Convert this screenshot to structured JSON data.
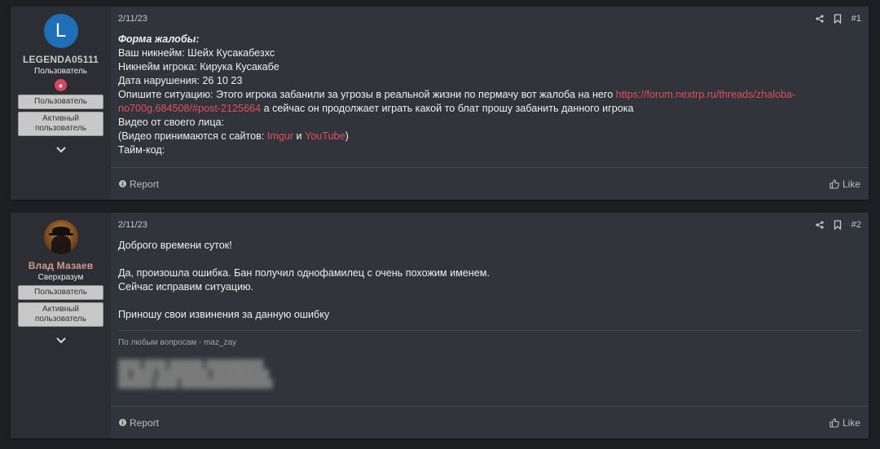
{
  "posts": [
    {
      "avatar_letter": "L",
      "username": "LEGENDA05111",
      "user_title": "Пользователь",
      "banners": [
        "Пользователь",
        "Активный пользователь"
      ],
      "date": "2/11/23",
      "number": "#1",
      "report_label": "Report",
      "like_label": "Like",
      "body": {
        "heading": "Форма жалобы:",
        "line1": "Ваш никнейм: Шейх Кусакабезхс",
        "line2": "Никнейм игрока: Кирука Кусакабе",
        "line3": "Дата нарушения: 26 10 23",
        "situation_prefix": "Опишите ситуацию: Этого игрока забанили за угрозы в реальной жизни по пермачу вот жалоба на него ",
        "situation_link": "https://forum.nextrp.ru/threads/zhaloba-no700g.684508/#post-2125664",
        "situation_suffix": " а сейчас он продолжает играть какой то блат прошу забанить данного игрока",
        "line5": "Видео от своего лица:",
        "line6_prefix": "(Видео принимаются с сайтов: ",
        "line6_link1": "Imgur",
        "line6_mid": " и ",
        "line6_link2": "YouTube",
        "line6_suffix": ")",
        "line7": "Тайм-код:"
      }
    },
    {
      "username": "Влад Мазаев",
      "user_title": "Сверхразум",
      "banners": [
        "Пользователь",
        "Активный пользователь"
      ],
      "date": "2/11/23",
      "number": "#2",
      "report_label": "Report",
      "like_label": "Like",
      "body": {
        "line1": "Доброго времени суток!",
        "line2": "Да, произошла ошибка. Бан получил однофамилец с очень похожим именем.",
        "line3": "Сейчас исправим ситуацию.",
        "line4": "Приношу свои извинения за данную ошибку"
      },
      "signature": "По любым вопросам - maz_zay"
    }
  ],
  "colors": {
    "link": "#e0505a",
    "avatar_blue": "#1f6fb8",
    "background": "#1e1f23",
    "post_bg": "#31343b"
  },
  "icons": [
    "share-icon",
    "bookmark-icon",
    "chevron-down-icon",
    "info-icon",
    "thumbs-up-icon",
    "staff-badge-icon"
  ]
}
